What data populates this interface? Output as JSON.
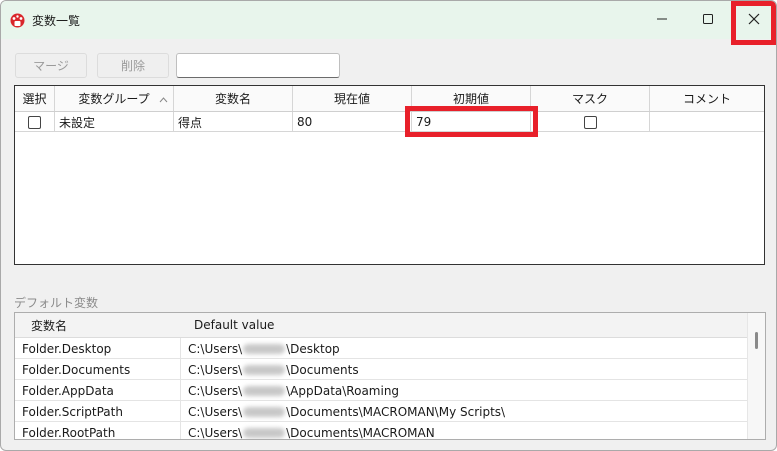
{
  "window": {
    "title": "変数一覧"
  },
  "toolbar": {
    "merge_label": "マージ",
    "delete_label": "削除",
    "name_input_value": ""
  },
  "variables_grid": {
    "columns": [
      "選択",
      "変数グループ",
      "変数名",
      "現在値",
      "初期値",
      "マスク",
      "コメント"
    ],
    "rows": [
      {
        "selected": false,
        "group": "未設定",
        "name": "得点",
        "current": "80",
        "initial": "79",
        "mask": false,
        "comment": ""
      }
    ]
  },
  "defaults": {
    "section_label": "デフォルト変数",
    "columns": [
      "変数名",
      "Default value"
    ],
    "rows": [
      {
        "name": "Folder.Desktop",
        "value_prefix": "C:\\Users\\",
        "value_suffix": "\\Desktop"
      },
      {
        "name": "Folder.Documents",
        "value_prefix": "C:\\Users\\",
        "value_suffix": "\\Documents"
      },
      {
        "name": "Folder.AppData",
        "value_prefix": "C:\\Users\\",
        "value_suffix": "\\AppData\\Roaming"
      },
      {
        "name": "Folder.ScriptPath",
        "value_prefix": "C:\\Users\\",
        "value_suffix": "\\Documents\\MACROMAN\\My Scripts\\"
      },
      {
        "name": "Folder.RootPath",
        "value_prefix": "C:\\Users\\",
        "value_suffix": "\\Documents\\MACROMAN"
      }
    ]
  },
  "colors": {
    "title_bar": "#e8f5ec",
    "highlight": "#e8202a"
  },
  "icons": {
    "app": "mushroom-icon",
    "minimize": "minimize-icon",
    "maximize": "maximize-icon",
    "close": "close-icon",
    "sort": "sort-up-icon"
  }
}
